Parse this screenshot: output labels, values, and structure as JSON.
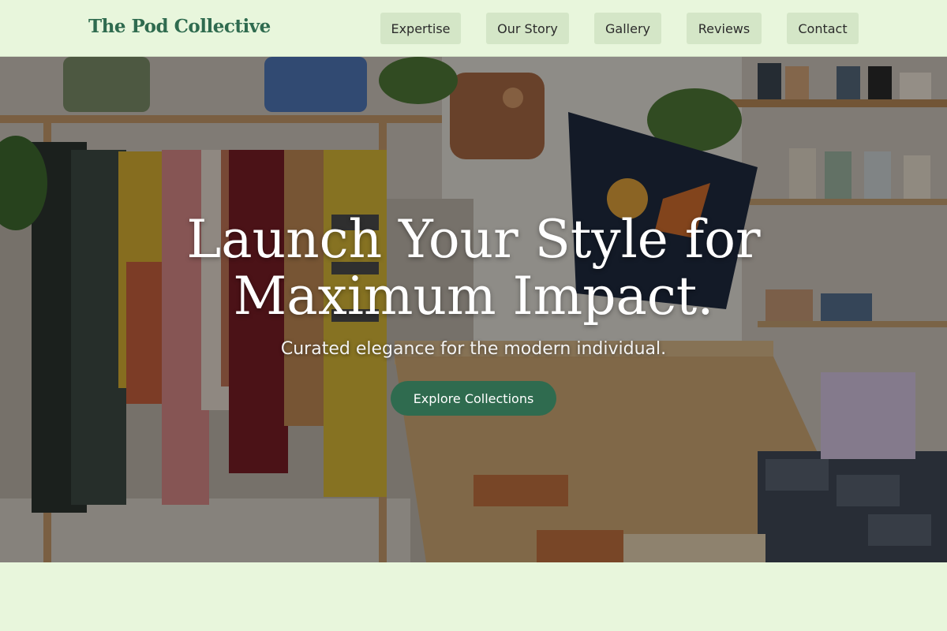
{
  "header": {
    "brand": "The Pod Collective",
    "nav": [
      "Expertise",
      "Our Story",
      "Gallery",
      "Reviews",
      "Contact"
    ]
  },
  "hero": {
    "title": "Launch Your Style for Maximum Impact.",
    "subtitle": "Curated elegance for the modern individual.",
    "cta_label": "Explore Collections",
    "background_image": "boutique-shop-interior-photo"
  },
  "colors": {
    "page_background": "#e8f6dc",
    "brand": "#2f6b4f",
    "nav_button": "#d4e6c7",
    "cta": "#2f6b4f"
  }
}
